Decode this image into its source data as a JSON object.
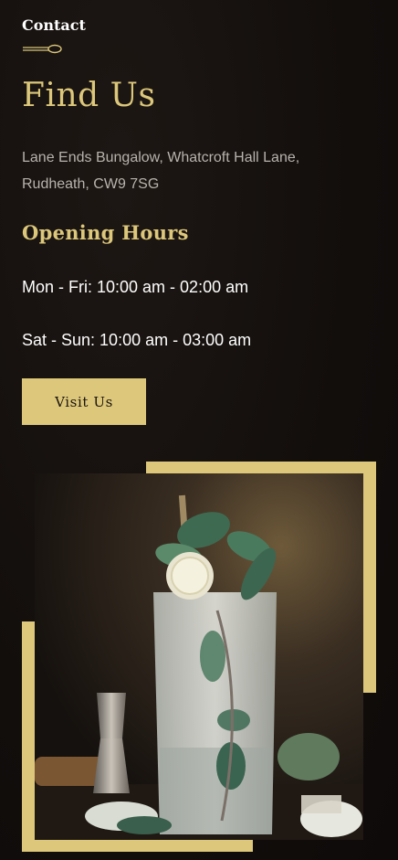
{
  "section": {
    "eyebrow": "Contact"
  },
  "heading": {
    "title": "Find Us"
  },
  "address": {
    "line1": "Lane Ends Bungalow, Whatcroft Hall Lane,",
    "line2": "Rudheath, CW9 7SG"
  },
  "hours": {
    "title": "Opening Hours",
    "weekdays": "Mon - Fri: 10:00 am - 02:00 am",
    "weekend": "Sat - Sun: 10:00 am - 03:00 am"
  },
  "cta": {
    "visit_label": "Visit Us"
  },
  "image": {
    "subject": "cocktail-photo"
  },
  "colors": {
    "accent": "#dcc77a",
    "background": "#140f0d",
    "text": "#ffffff",
    "muted_text": "#b9b3ad"
  }
}
